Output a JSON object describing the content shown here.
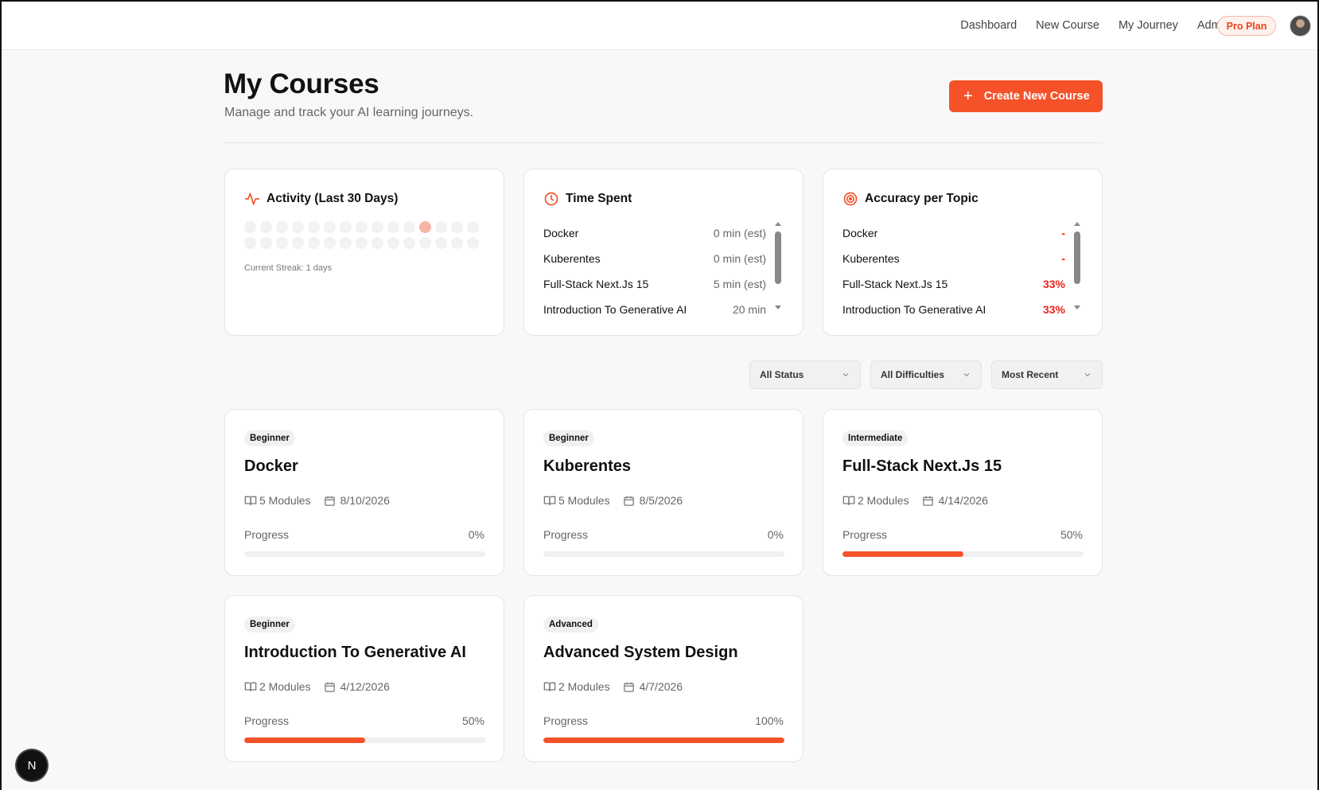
{
  "nav": {
    "links": [
      "Dashboard",
      "New Course",
      "My Journey",
      "Admin"
    ],
    "plan_badge": "Pro Plan"
  },
  "header": {
    "title": "My Courses",
    "subtitle": "Manage and track your AI learning journeys.",
    "create_button": "Create New Course"
  },
  "activity": {
    "title": "Activity (Last 30 Days)",
    "streak": "Current Streak: 1 days",
    "active_day_index": 11
  },
  "time_spent": {
    "title": "Time Spent",
    "rows": [
      {
        "name": "Docker",
        "value": "0 min (est)"
      },
      {
        "name": "Kuberentes",
        "value": "0 min (est)"
      },
      {
        "name": "Full-Stack Next.Js 15",
        "value": "5 min (est)"
      },
      {
        "name": "Introduction To Generative AI",
        "value": "20 min"
      }
    ]
  },
  "accuracy": {
    "title": "Accuracy per Topic",
    "rows": [
      {
        "name": "Docker",
        "value": "-"
      },
      {
        "name": "Kuberentes",
        "value": "-"
      },
      {
        "name": "Full-Stack Next.Js 15",
        "value": "33%"
      },
      {
        "name": "Introduction To Generative AI",
        "value": "33%"
      }
    ]
  },
  "filters": {
    "status": "All Status",
    "difficulty": "All Difficulties",
    "sort": "Most Recent"
  },
  "courses": [
    {
      "level": "Beginner",
      "title": "Docker",
      "modules": "5 Modules",
      "date": "8/10/2026",
      "progress_label": "Progress",
      "progress_text": "0%",
      "progress": 0
    },
    {
      "level": "Beginner",
      "title": "Kuberentes",
      "modules": "5 Modules",
      "date": "8/5/2026",
      "progress_label": "Progress",
      "progress_text": "0%",
      "progress": 0
    },
    {
      "level": "Intermediate",
      "title": "Full-Stack Next.Js 15",
      "modules": "2 Modules",
      "date": "4/14/2026",
      "progress_label": "Progress",
      "progress_text": "50%",
      "progress": 50
    },
    {
      "level": "Beginner",
      "title": "Introduction To Generative AI",
      "modules": "2 Modules",
      "date": "4/12/2026",
      "progress_label": "Progress",
      "progress_text": "50%",
      "progress": 50
    },
    {
      "level": "Advanced",
      "title": "Advanced System Design",
      "modules": "2 Modules",
      "date": "4/7/2026",
      "progress_label": "Progress",
      "progress_text": "100%",
      "progress": 100
    }
  ],
  "dev_badge": "N",
  "colors": {
    "accent": "#f5522a",
    "accuracy": "#e8231c"
  }
}
